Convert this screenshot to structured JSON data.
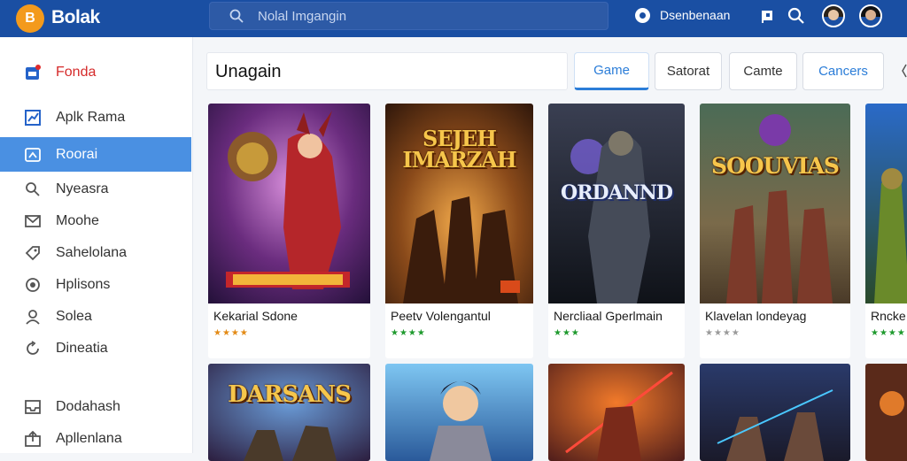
{
  "app": {
    "title": "Bolak",
    "logo_letter": "B"
  },
  "search": {
    "placeholder": "Nolal Imgangin"
  },
  "header": {
    "user_name": "Dsenbenaan"
  },
  "sidebar": {
    "items": [
      {
        "label": "Fonda"
      },
      {
        "label": "Aplk Rama"
      },
      {
        "label": "Roorai"
      },
      {
        "label": "Nyeasra"
      },
      {
        "label": "Moohe"
      },
      {
        "label": "Sahelolana"
      },
      {
        "label": "Hplisons"
      },
      {
        "label": "Solea"
      },
      {
        "label": "Dineatia"
      },
      {
        "label": "Dodahash"
      },
      {
        "label": "Apllenlana"
      }
    ]
  },
  "main": {
    "section_title": "Unagain",
    "tabs": [
      {
        "label": "Game"
      },
      {
        "label": "Satorat"
      },
      {
        "label": "Camte"
      },
      {
        "label": "Cancers"
      }
    ]
  },
  "games": [
    {
      "name": "Kekarial Sdone",
      "stars": "★★★★",
      "star_color": "#e38b16",
      "art_title": ""
    },
    {
      "name": "Peetv Volengantul",
      "stars": "★★★★",
      "star_color": "#1f9a2e",
      "art_title": "SEJEH IMARZAH"
    },
    {
      "name": "Nercliaal Gperlmain",
      "stars": "★★★",
      "star_color": "#1f9a2e",
      "art_title": "ORDANND"
    },
    {
      "name": "Klavelan londeyag",
      "stars": "★★★★",
      "star_color": "#9a9a9a",
      "art_title": "SOOUVIAS"
    },
    {
      "name": "Rncke",
      "stars": "★★★★",
      "star_color": "#1f9a2e",
      "art_title": ""
    }
  ],
  "games_row2": [
    {
      "art_title": "DARSANS"
    }
  ]
}
